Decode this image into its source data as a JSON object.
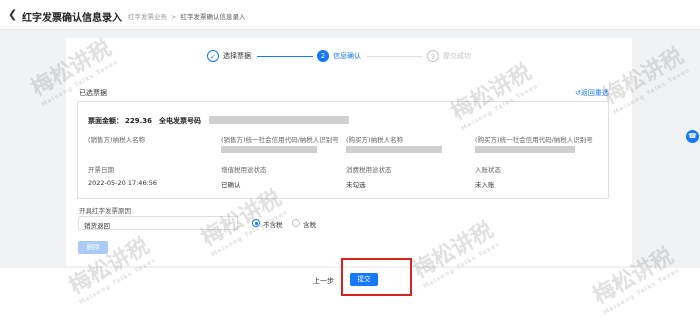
{
  "header": {
    "title": "红字发票确认信息录入",
    "breadcrumb": [
      "红字发票业务",
      "红字发票确认信息录入"
    ]
  },
  "steps": [
    {
      "num": "✓",
      "label": "选择票据",
      "state": "done"
    },
    {
      "num": "2",
      "label": "信息确认",
      "state": "active"
    },
    {
      "num": "3",
      "label": "提交成功",
      "state": "pending"
    }
  ],
  "selected": {
    "title": "已选票据",
    "reselect": "返回重选",
    "amount_label": "票面金额：",
    "amount_value": "229.36",
    "invoice_no_label": "全电发票号码",
    "row1_labels": [
      "(销售方)纳税人名称",
      "(销售方)统一社会信用代码/纳税人识别号",
      "(购买方)纳税人名称",
      "(购买方)统一社会信用代码/纳税人识别号"
    ],
    "row2_labels": [
      "开票日期",
      "增值税用途状态",
      "消费税用途状态",
      "入账状态"
    ],
    "row2_values": [
      "2022-05-20 17:46:56",
      "已确认",
      "未勾选",
      "未入账"
    ]
  },
  "form": {
    "reason_label": "开具红字发票原因",
    "reason_value": "销货退回",
    "radio_options": [
      "不含税",
      "含税"
    ],
    "radio_selected": "不含税",
    "delete_label": "删除"
  },
  "footer": {
    "prev_label": "上一步",
    "submit_label": "提交"
  },
  "watermark": {
    "text": "梅松讲税",
    "sub": "Meisong Talks Taxes"
  },
  "colors": {
    "accent": "#1677ff",
    "highlight": "#d8241f"
  }
}
